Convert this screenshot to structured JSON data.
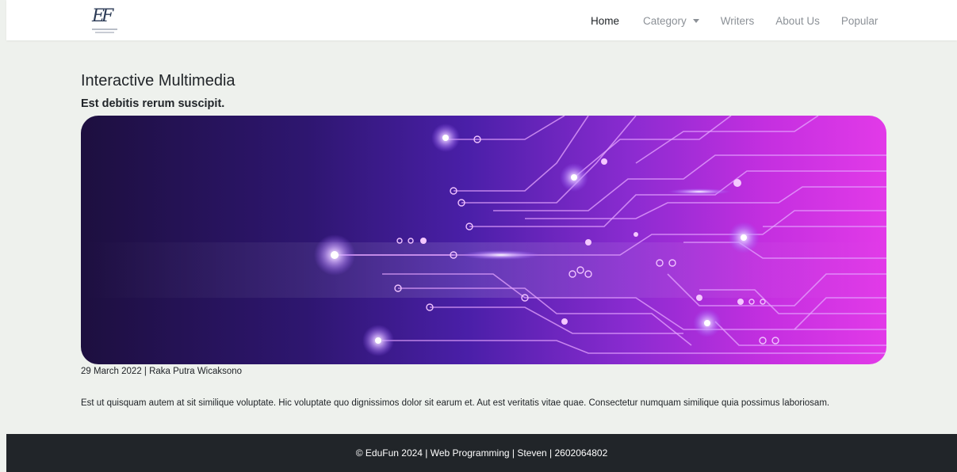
{
  "navbar": {
    "logo_icon": "edufun-logo",
    "items": [
      {
        "label": "Home",
        "active": true
      },
      {
        "label": "Category",
        "dropdown": true
      },
      {
        "label": "Writers"
      },
      {
        "label": "About Us"
      },
      {
        "label": "Popular"
      }
    ]
  },
  "article": {
    "title": "Interactive Multimedia",
    "subtitle": "Est debitis rerum suscipit.",
    "image_icon": "circuit-board-banner",
    "meta": "29 March 2022 | Raka Putra Wicaksono",
    "body": "Est ut quisquam autem at sit similique voluptate. Hic voluptate quo dignissimos dolor sit earum et. Aut est veritatis vitae quae. Consectetur numquam similique quia possimus laboriosam."
  },
  "footer": {
    "text": "© EduFun 2024 | Web Programming | Steven | 2602064802"
  },
  "colors": {
    "page_bg": "#eef1ed",
    "navbar_bg": "#ffffff",
    "footer_bg": "#212529",
    "text": "#212529",
    "nav_muted": "#8c9197",
    "banner_dark": "#1d0f3f",
    "banner_purple": "#4a1fa8",
    "banner_magenta": "#e22ee6"
  }
}
